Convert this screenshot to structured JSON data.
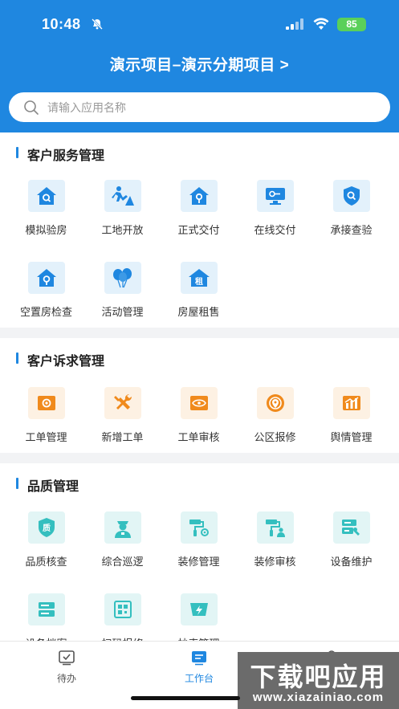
{
  "status_bar": {
    "time": "10:48",
    "battery": "85"
  },
  "project_title": "演示项目–演示分期项目 >",
  "search": {
    "placeholder": "请输入应用名称"
  },
  "sections": [
    {
      "title": "客户服务管理",
      "items": [
        "模拟验房",
        "工地开放",
        "正式交付",
        "在线交付",
        "承接查验",
        "空置房检查",
        "活动管理",
        "房屋租售"
      ]
    },
    {
      "title": "客户诉求管理",
      "items": [
        "工单管理",
        "新增工单",
        "工单审核",
        "公区报修",
        "舆情管理"
      ]
    },
    {
      "title": "品质管理",
      "items": [
        "品质核查",
        "综合巡逻",
        "装修管理",
        "装修审核",
        "设备维护",
        "设备档案",
        "扫码报修",
        "抄表管理"
      ]
    }
  ],
  "icon_text": {
    "rent": "租",
    "quality": "质"
  },
  "tabbar": {
    "tabs": [
      "待办",
      "工作台",
      "我的"
    ]
  },
  "watermark": {
    "line1": "下载吧应用",
    "line2": "www.xiazainiao.com"
  },
  "colors": {
    "primary": "#1f87e0",
    "orange": "#f08a1c",
    "teal": "#34bfbf"
  }
}
